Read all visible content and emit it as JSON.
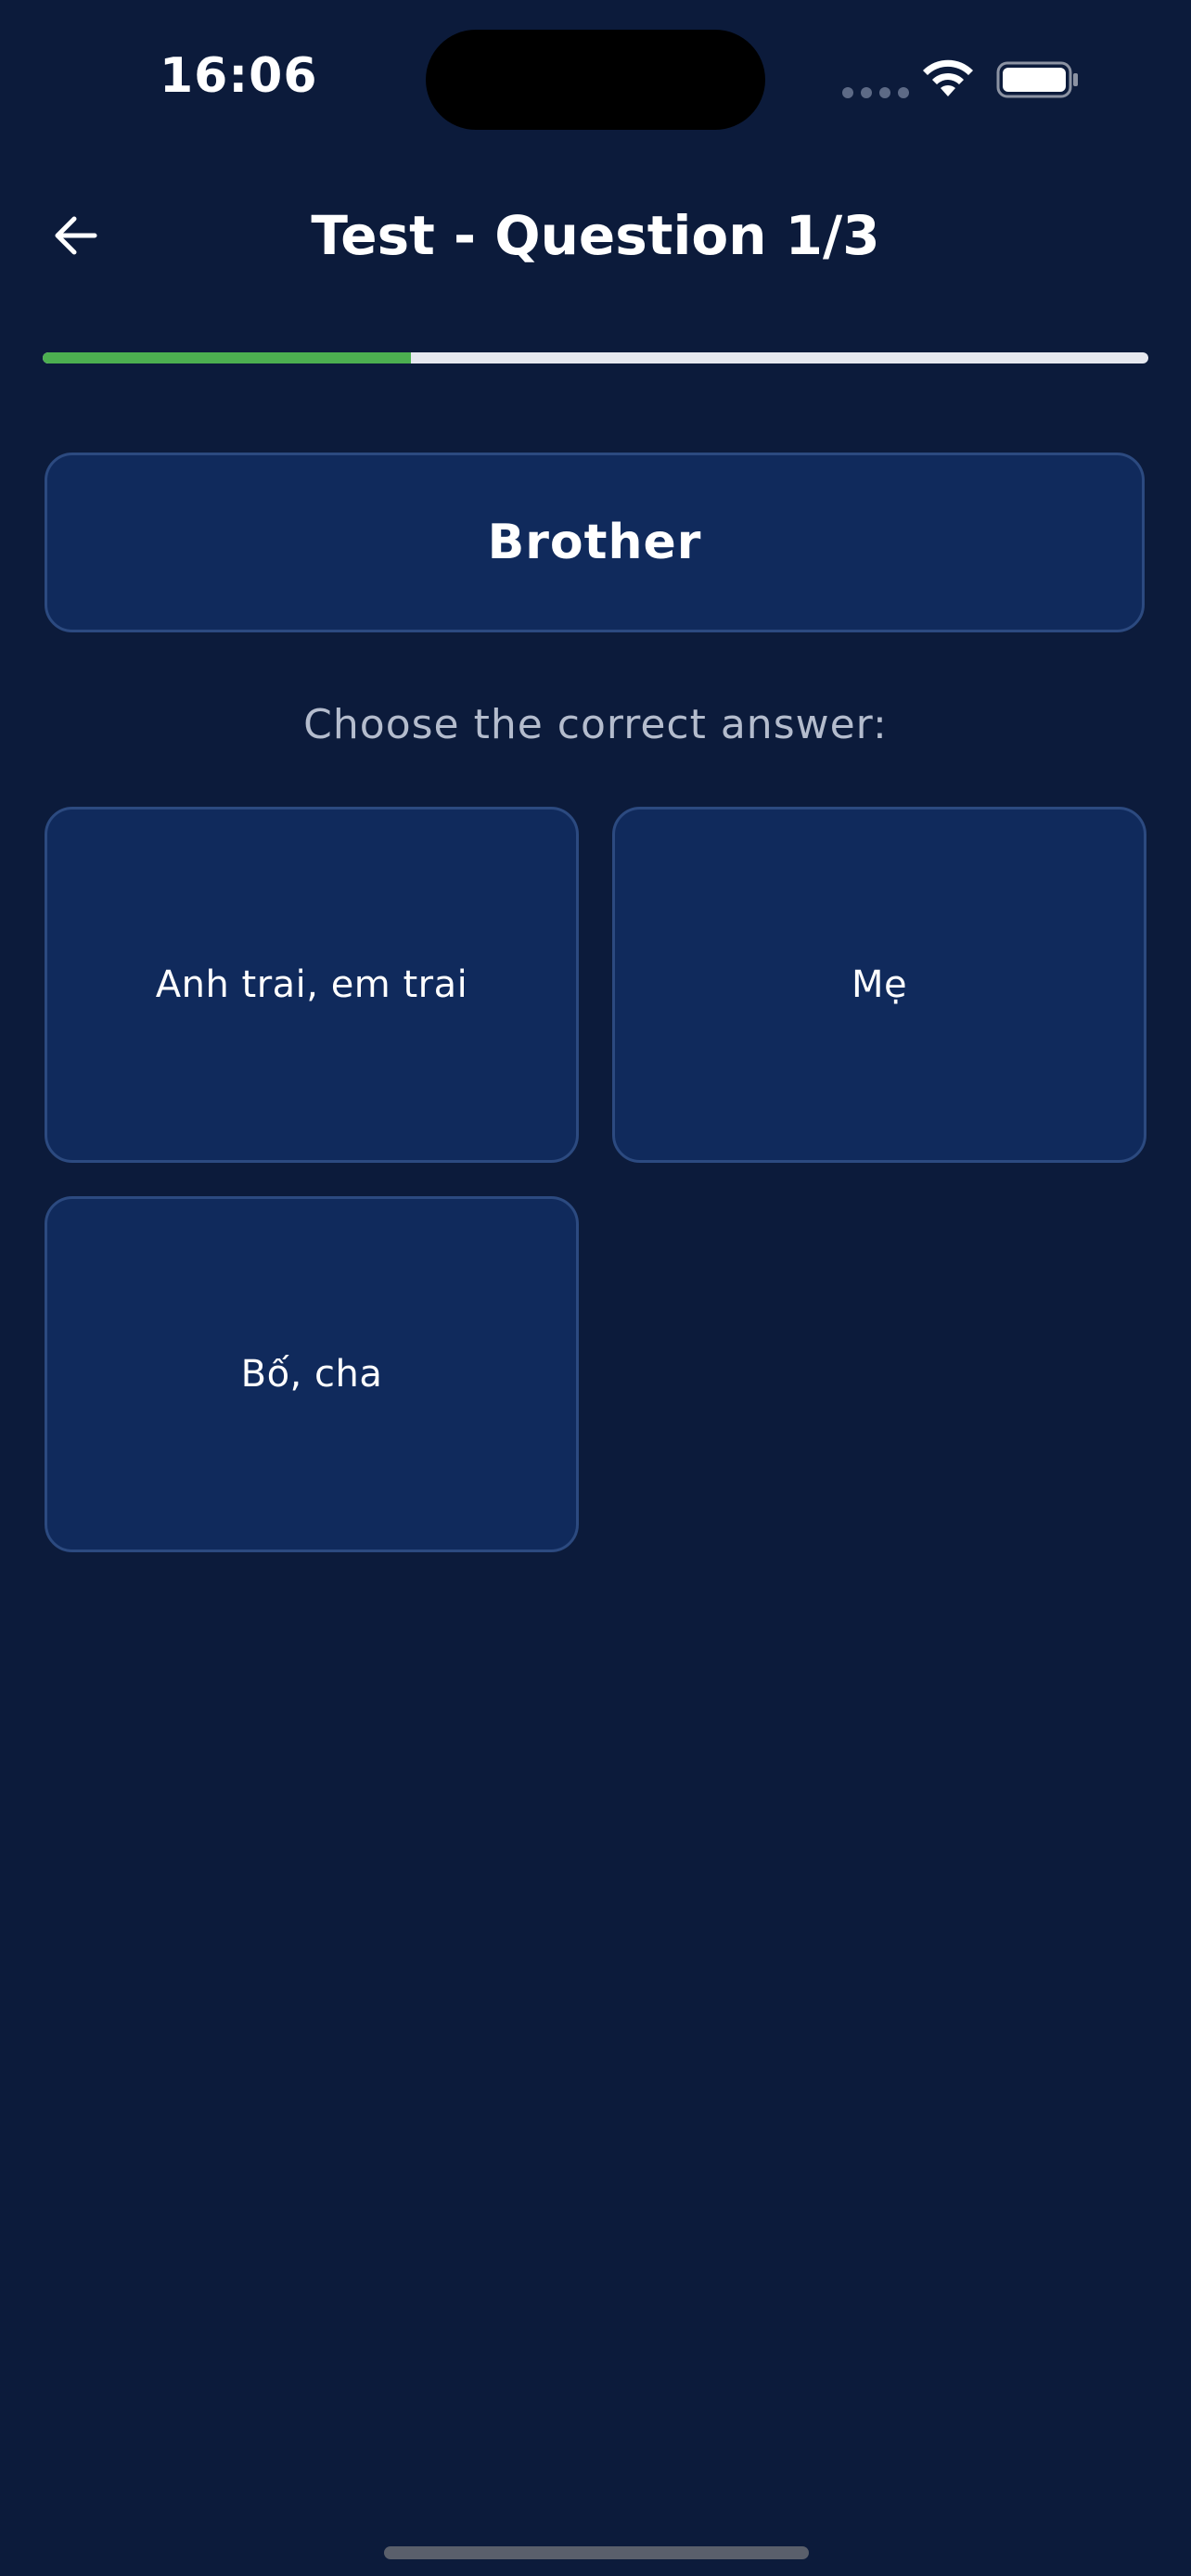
{
  "status_bar": {
    "time": "16:06"
  },
  "header": {
    "title": "Test - Question 1/3",
    "back_icon": "arrow-left-icon"
  },
  "progress": {
    "current": 1,
    "total": 3,
    "fraction": 0.3333,
    "fill_color": "#4caf50",
    "track_color": "#e6e8ef"
  },
  "question": {
    "word": "Brother"
  },
  "instruction": "Choose the correct answer:",
  "answers": [
    {
      "label": "Anh trai, em trai"
    },
    {
      "label": "Mẹ"
    },
    {
      "label": "Bố, cha"
    }
  ],
  "colors": {
    "background": "#0c1b3b",
    "card": "#102a5c",
    "card_border": "#2c4a80"
  }
}
